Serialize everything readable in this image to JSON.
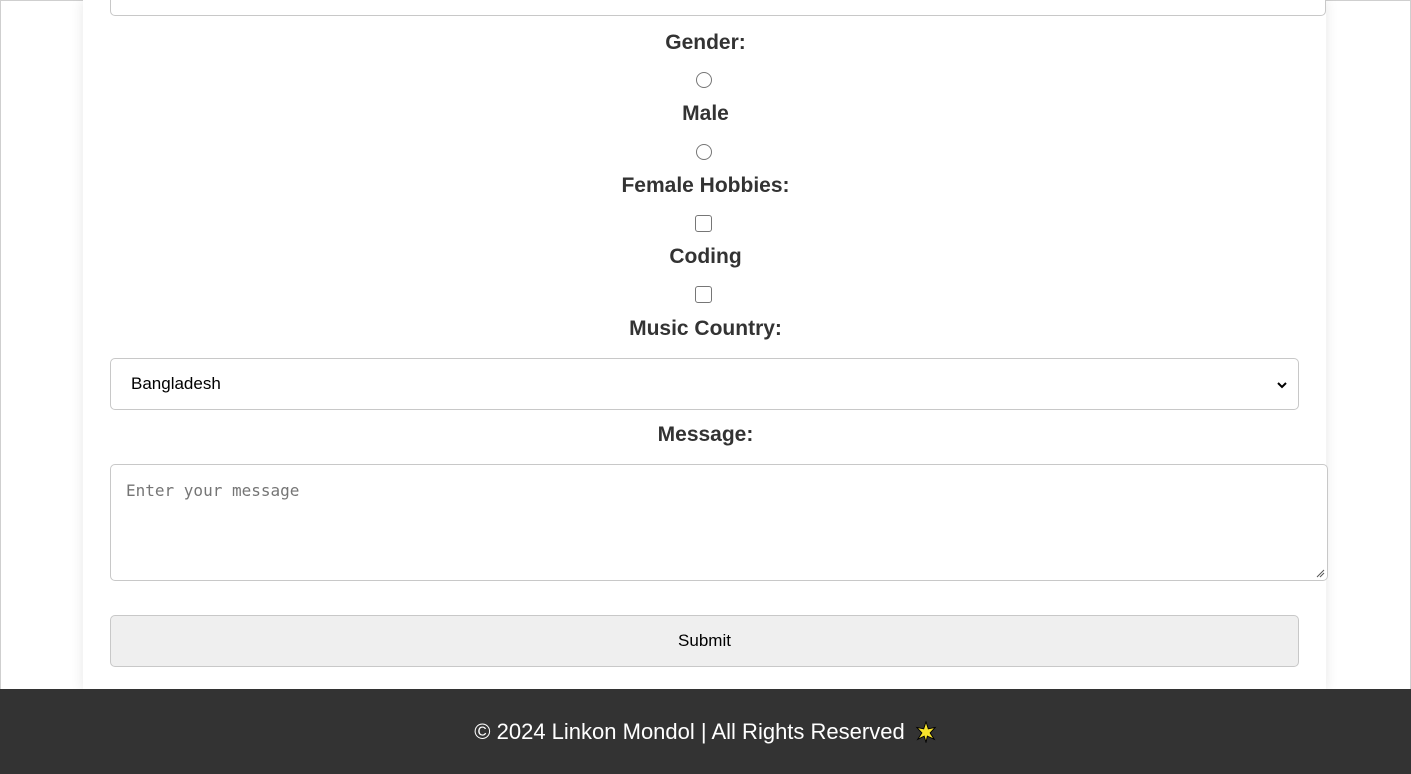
{
  "form": {
    "gender_label": "Gender:",
    "male_label": "Male",
    "female_hobbies_label": "Female Hobbies:",
    "coding_label": "Coding",
    "music_country_label": "Music Country:",
    "country_selected": "Bangladesh",
    "message_label": "Message:",
    "message_placeholder": "Enter your message",
    "submit_label": "Submit"
  },
  "footer": {
    "text": "© 2024 Linkon Mondol | All Rights Reserved",
    "icon": "star-icon"
  },
  "colors": {
    "footer_bg": "#333333",
    "label_text": "#333333",
    "button_bg": "#efefef"
  }
}
